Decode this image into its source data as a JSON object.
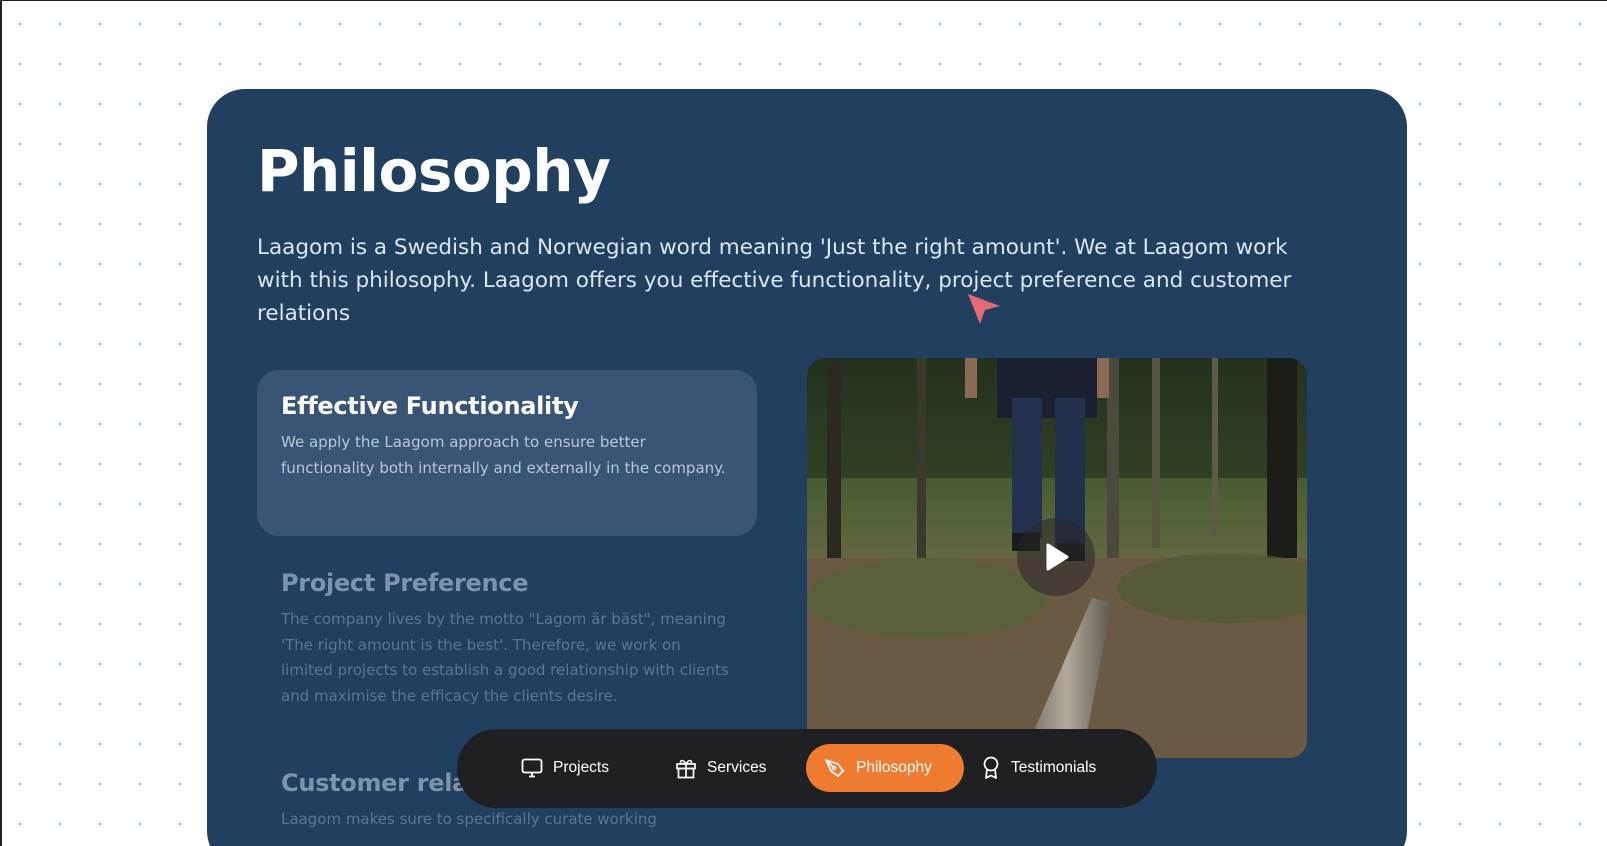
{
  "page": {
    "title": "Philosophy",
    "intro": "Laagom is a Swedish and Norwegian word meaning 'Just the right amount'. We at Laagom work with this philosophy. Laagom offers you effective functionality, project preference and customer relations"
  },
  "features": [
    {
      "title": "Effective Functionality",
      "text": "We apply the Laagom approach to ensure better functionality both internally and externally in the company.",
      "active": true
    },
    {
      "title": "Project Preference",
      "text": "The company lives by the motto \"Lagom är bäst\", meaning 'The right amount is the best'. Therefore, we work on limited projects to establish a good relationship with clients and maximise the efficacy the clients desire.",
      "active": false
    },
    {
      "title": "Customer relations",
      "text": "Laagom makes sure to specifically curate working",
      "active": false
    }
  ],
  "media": {
    "icon": "play-icon"
  },
  "nav": {
    "items": [
      {
        "label": "Projects",
        "icon": "monitor-icon",
        "active": false
      },
      {
        "label": "Services",
        "icon": "gift-icon",
        "active": false
      },
      {
        "label": "Philosophy",
        "icon": "pen-tool-icon",
        "active": true
      },
      {
        "label": "Testimonials",
        "icon": "award-icon",
        "active": false
      }
    ]
  },
  "colors": {
    "card_bg": "#21405f",
    "active_feature_bg": "#385575",
    "dock_bg": "#1f2023",
    "accent": "#ee7b2f",
    "cursor": "#e56a76"
  }
}
